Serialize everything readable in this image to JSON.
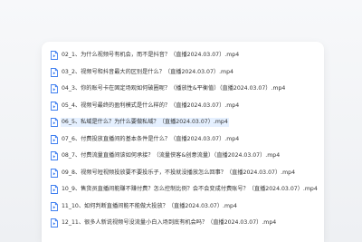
{
  "files": [
    {
      "name": "02_1、为什么视频号有机会，而不是抖音？（直播2024.03.07）.mp4",
      "selected": false
    },
    {
      "name": "03_2、视频号和抖音最大的区别是什么？（直播2024.03.07）.mp4",
      "selected": false
    },
    {
      "name": "04_3、你的账号卡在固定场观如何破圈呢？（播放性&平衡值）（直播2024.03.07）.mp4",
      "selected": false
    },
    {
      "name": "05_4、视频号最终的盈利模式是什么样的？（直播2024.03.07）.mp4",
      "selected": false
    },
    {
      "name": "06_5、私域是什么？为什么要做私域？（直播2024.03.07）.mp4",
      "selected": true
    },
    {
      "name": "07_6、付费投放直播间的基本条件是什么？（直播2024.03.07）.mp4",
      "selected": false
    },
    {
      "name": "08_7、付费流量直播间该如何承接？（流量侠客&创意流量）（直播2024.03.07）.mp4",
      "selected": false
    },
    {
      "name": "09_8、视频号短视频投放要不要投乐子，不投就没播放怎么回事？（直播2024.03.07）.mp4",
      "selected": false
    },
    {
      "name": "10_9、售货员直播间能赚不赚付费？怎么控制比例？会不会变成付费账号？（直播2024.03.07）.mp4",
      "selected": false
    },
    {
      "name": "11_10、如何判断直播间能不能做大投放？（直播2024.03.07）.mp4",
      "selected": false
    },
    {
      "name": "12_11、很多人新说视频号没流量小白入场到底有机会吗？（直播2024.03.07）.mp4",
      "selected": false
    }
  ],
  "colors": {
    "icon_blue": "#3d7ef0",
    "selected_bg": "#e5f0ff"
  },
  "icon": "video-file-icon"
}
